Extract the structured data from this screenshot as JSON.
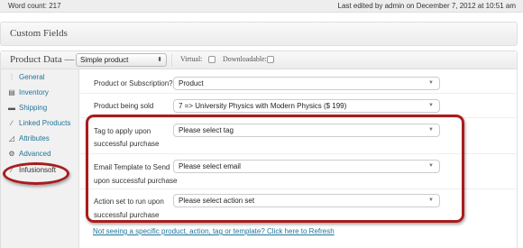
{
  "status_bar": {
    "word_count": "Word count: 217",
    "last_edited": "Last edited by admin on December 7, 2012 at 10:51 am"
  },
  "custom_fields": {
    "title": "Custom Fields"
  },
  "product_data": {
    "title": "Product Data —",
    "product_type": "Simple product",
    "virtual_label": "Virtual:",
    "downloadable_label": "Downloadable:"
  },
  "sidebar": {
    "items": [
      {
        "label": "General",
        "icon": "sliders-icon"
      },
      {
        "label": "Inventory",
        "icon": "boxes-icon"
      },
      {
        "label": "Shipping",
        "icon": "truck-icon"
      },
      {
        "label": "Linked Products",
        "icon": "link-icon"
      },
      {
        "label": "Attributes",
        "icon": "ruler-icon"
      },
      {
        "label": "Advanced",
        "icon": "gear-icon"
      },
      {
        "label": "Infusionsoft",
        "icon": "infusionsoft-icon"
      }
    ]
  },
  "form": {
    "product_or_subscription": {
      "label": "Product or Subscription?",
      "value": "Product"
    },
    "product_being_sold": {
      "label": "Product being sold",
      "value": "7 => University Physics with Modern Physics ($ 199)"
    },
    "tag": {
      "label_line1": "Tag to apply upon",
      "label_line2": "successful purchase",
      "value": "Please select tag"
    },
    "email": {
      "label_line1": "Email Template to Send",
      "label_line2": "upon successful purchase",
      "value": "Please select email"
    },
    "action": {
      "label_line1": "Action set to run upon",
      "label_line2": "successful purchase",
      "value": "Please select action set"
    }
  },
  "refresh_link": "Not seeing a specific product, action, tag or template? Click here to Refresh",
  "colors": {
    "link": "#21759b",
    "annotation": "#a81c1c"
  }
}
